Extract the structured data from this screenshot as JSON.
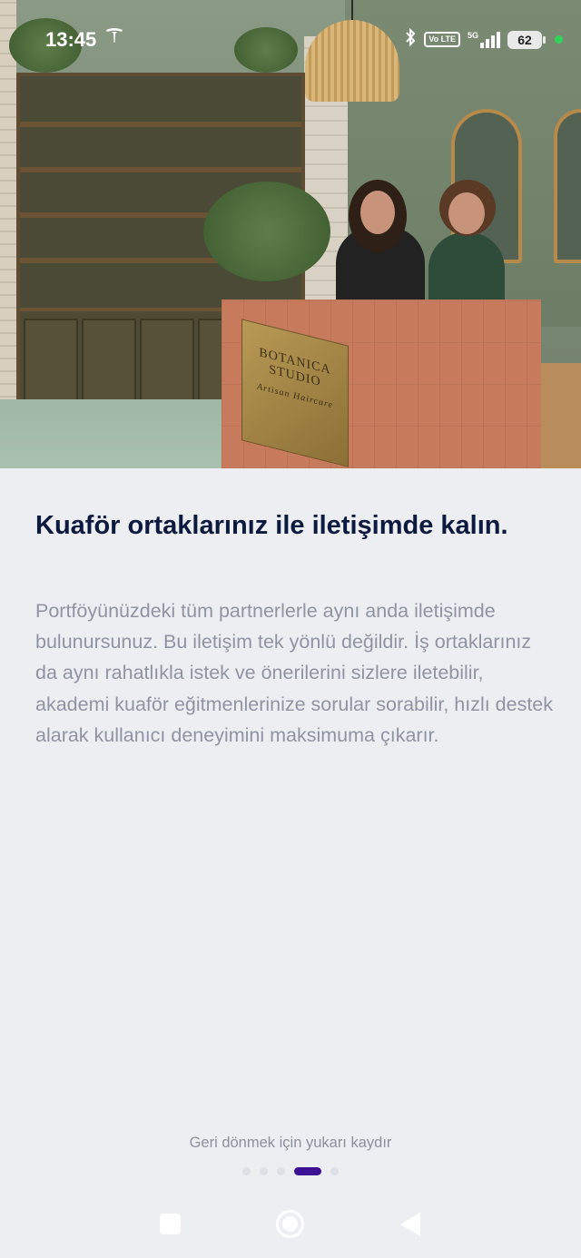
{
  "status_bar": {
    "time": "13:45",
    "volte_label": "Vo LTE",
    "network": "5G",
    "battery": "62",
    "icons": [
      "tesla-icon",
      "bluetooth-icon",
      "volte-icon",
      "signal-icon",
      "battery-icon",
      "privacy-dot-icon"
    ]
  },
  "hero": {
    "plaque_line1": "BOTANICA STUDIO",
    "plaque_line2": "Artisan Haircare"
  },
  "onboarding": {
    "title": "Kuaför ortaklarınız ile iletişimde kalın.",
    "body": "Portföyünüzdeki tüm partnerlerle aynı anda iletişimde bulunursunuz. Bu iletişim tek yönlü değildir. İş ortaklarınız da aynı rahatlıkla istek ve önerilerini sizlere iletebilir, akademi kuaför eğitmenlerinize sorular sorabilir, hızlı destek alarak kullanıcı deneyimini maksimuma çıkarır.",
    "swipe_hint": "Geri dönmek için yukarı kaydır",
    "page_total": 5,
    "page_current": 4
  },
  "colors": {
    "background": "#eceef2",
    "title": "#0d1a3f",
    "body": "#8f94a3",
    "accent": "#3b1196"
  },
  "nav_bar": {
    "icons": [
      "recent-apps-icon",
      "home-icon",
      "back-icon"
    ]
  }
}
